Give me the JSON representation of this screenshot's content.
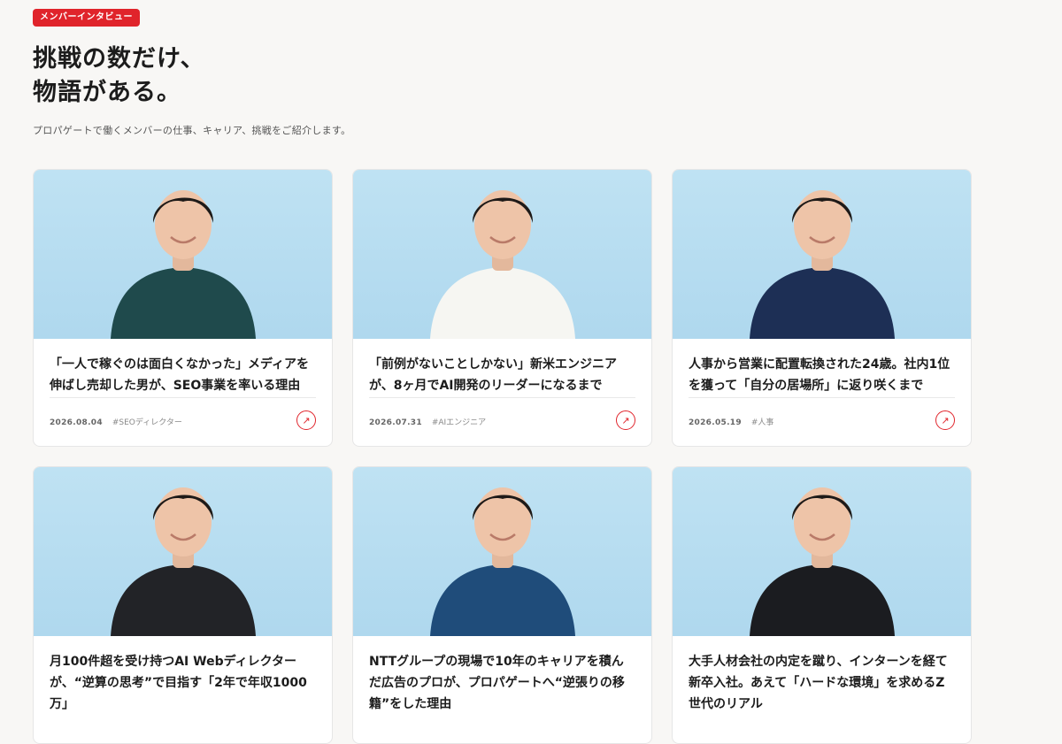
{
  "section": {
    "badge": "メンバーインタビュー",
    "title_line1": "挑戦の数だけ、",
    "title_line2": "物語がある。",
    "lead": "プロパゲートで働くメンバーの仕事、キャリア、挑戦をご紹介します。"
  },
  "colors": {
    "accent": "#e0242b",
    "photo_bg": "#b9dff2"
  },
  "cards": [
    {
      "title": "「一人で稼ぐのは面白くなかった」メディアを伸ばし売却した男が、SEO事業を率いる理由",
      "date": "2026.08.04",
      "tag": "#SEOディレクター",
      "arrow": "↗",
      "icon": "arrow-up-right-icon",
      "shirt": "#1f4a4c"
    },
    {
      "title": "「前例がないことしかない」新米エンジニアが、8ヶ月でAI開発のリーダーになるまで",
      "date": "2026.07.31",
      "tag": "#AIエンジニア",
      "arrow": "↗",
      "icon": "arrow-up-right-icon",
      "shirt": "#f6f6f2"
    },
    {
      "title": "人事から営業に配置転換された24歳。社内1位を獲って「自分の居場所」に返り咲くまで",
      "date": "2026.05.19",
      "tag": "#人事",
      "arrow": "↗",
      "icon": "arrow-up-right-icon",
      "shirt": "#1d2f55"
    },
    {
      "title": "月100件超を受け持つAI Webディレクターが、“逆算の思考”で目指す「2年で年収1000万」",
      "date": "",
      "tag": "",
      "arrow": "",
      "icon": "",
      "shirt": "#222327"
    },
    {
      "title": "NTTグループの現場で10年のキャリアを積んだ広告のプロが、プロパゲートへ“逆張りの移籍”をした理由",
      "date": "",
      "tag": "",
      "arrow": "",
      "icon": "",
      "shirt": "#1f4c7a"
    },
    {
      "title": "大手人材会社の内定を蹴り、インターンを経て新卒入社。あえて「ハードな環境」を求めるZ世代のリアル",
      "date": "",
      "tag": "",
      "arrow": "",
      "icon": "",
      "shirt": "#1b1c20"
    }
  ]
}
